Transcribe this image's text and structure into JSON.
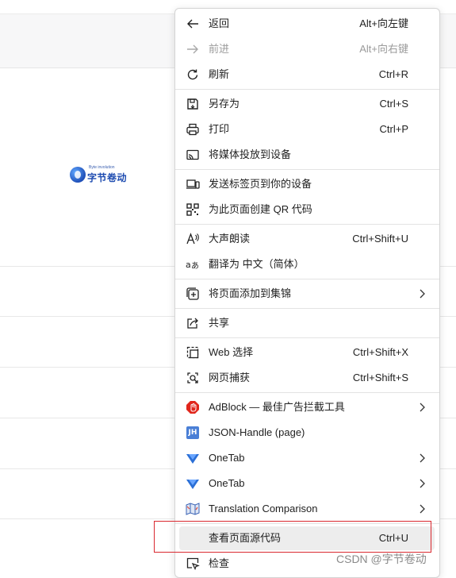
{
  "logo": {
    "small_text": "Byte involution",
    "main_text": "字节卷动"
  },
  "menu": {
    "items": [
      {
        "label": "返回",
        "shortcut": "Alt+向左键",
        "icon": "back-arrow-icon",
        "disabled": false
      },
      {
        "label": "前进",
        "shortcut": "Alt+向右键",
        "icon": "forward-arrow-icon",
        "disabled": true
      },
      {
        "label": "刷新",
        "shortcut": "Ctrl+R",
        "icon": "refresh-icon",
        "disabled": false
      },
      {
        "label": "另存为",
        "shortcut": "Ctrl+S",
        "icon": "save-icon",
        "disabled": false
      },
      {
        "label": "打印",
        "shortcut": "Ctrl+P",
        "icon": "printer-icon",
        "disabled": false
      },
      {
        "label": "将媒体投放到设备",
        "shortcut": "",
        "icon": "cast-icon",
        "disabled": false
      },
      {
        "label": "发送标签页到你的设备",
        "shortcut": "",
        "icon": "send-to-device-icon",
        "disabled": false
      },
      {
        "label": "为此页面创建 QR 代码",
        "shortcut": "",
        "icon": "qr-code-icon",
        "disabled": false
      },
      {
        "label": "大声朗读",
        "shortcut": "Ctrl+Shift+U",
        "icon": "read-aloud-icon",
        "disabled": false
      },
      {
        "label": "翻译为 中文（简体）",
        "shortcut": "",
        "icon": "translate-icon",
        "disabled": false
      },
      {
        "label": "将页面添加到集锦",
        "shortcut": "",
        "icon": "collections-icon",
        "disabled": false
      },
      {
        "label": "共享",
        "shortcut": "",
        "icon": "share-icon",
        "disabled": false
      },
      {
        "label": "Web 选择",
        "shortcut": "Ctrl+Shift+X",
        "icon": "web-select-icon",
        "disabled": false
      },
      {
        "label": "网页捕获",
        "shortcut": "Ctrl+Shift+S",
        "icon": "web-capture-icon",
        "disabled": false
      },
      {
        "label": "AdBlock — 最佳广告拦截工具",
        "shortcut": "",
        "icon": "adblock-icon",
        "disabled": false
      },
      {
        "label": "JSON-Handle (page)",
        "shortcut": "",
        "icon": "json-handle-icon",
        "icon_text": "JH",
        "disabled": false
      },
      {
        "label": "OneTab",
        "shortcut": "",
        "icon": "onetab-icon",
        "disabled": false
      },
      {
        "label": "OneTab",
        "shortcut": "",
        "icon": "onetab-icon",
        "disabled": false
      },
      {
        "label": "Translation Comparison",
        "shortcut": "",
        "icon": "translation-comparison-icon",
        "disabled": false
      },
      {
        "label": "查看页面源代码",
        "shortcut": "Ctrl+U",
        "icon": "",
        "disabled": false
      },
      {
        "label": "检查",
        "shortcut": "",
        "icon": "inspect-icon",
        "disabled": false
      }
    ]
  },
  "colors": {
    "highlight_box": "#d9282f",
    "adblock_red": "#e1261c",
    "json_handle_blue": "#4a7fd6",
    "onetab_blue": "#2b6fd6"
  },
  "watermark": "CSDN @字节卷动"
}
